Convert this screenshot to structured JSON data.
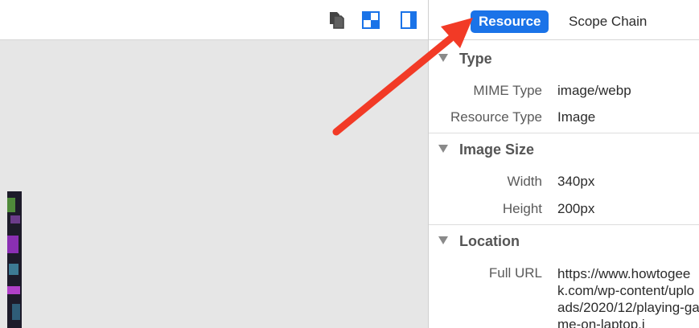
{
  "tabs": {
    "resource": "Resource",
    "scope_chain": "Scope Chain"
  },
  "sections": {
    "type": {
      "title": "Type",
      "mime_type_label": "MIME Type",
      "mime_type_value": "image/webp",
      "resource_type_label": "Resource Type",
      "resource_type_value": "Image"
    },
    "image_size": {
      "title": "Image Size",
      "width_label": "Width",
      "width_value": "340px",
      "height_label": "Height",
      "height_value": "200px"
    },
    "location": {
      "title": "Location",
      "full_url_label": "Full URL",
      "full_url_value": "https://www.howtogeek.com/wp-content/uploads/2020/12/playing-game-on-laptop.j"
    }
  },
  "toolbar_icons": [
    "document-icon",
    "dock-bottom-icon",
    "dock-right-icon"
  ],
  "colors": {
    "active_tab": "#1a73e8",
    "arrow": "#f23a26",
    "canvas_bg": "#e6e6e6"
  }
}
